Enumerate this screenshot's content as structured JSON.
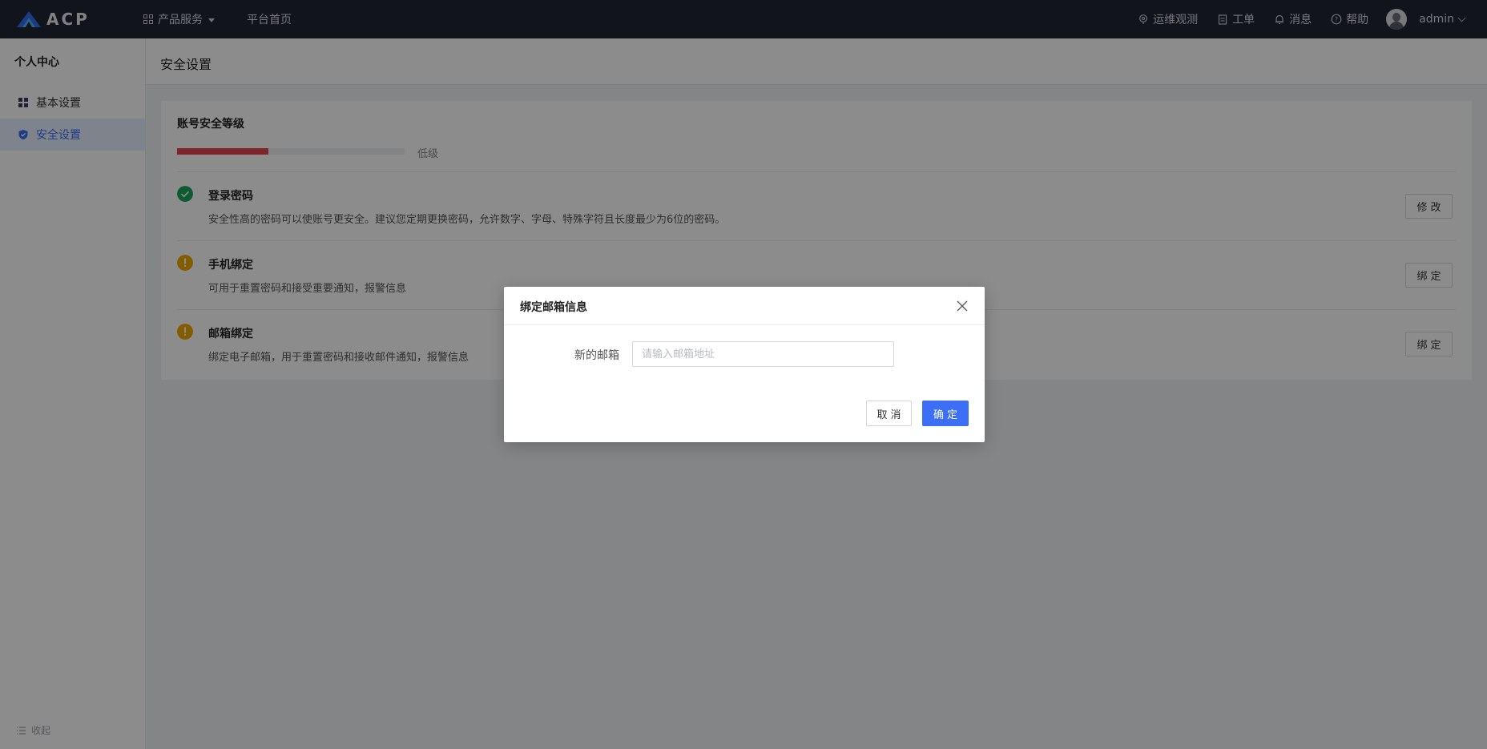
{
  "app": {
    "logo_text": "ACP"
  },
  "topnav": {
    "products_label": "产品服务",
    "home_label": "平台首页"
  },
  "topright": {
    "ops_label": "运维观测",
    "tickets_label": "工单",
    "messages_label": "消息",
    "help_label": "帮助",
    "user_name": "admin"
  },
  "sidebar": {
    "title": "个人中心",
    "items": [
      {
        "label": "基本设置",
        "icon": "grid-icon",
        "active": false
      },
      {
        "label": "安全设置",
        "icon": "shield-icon",
        "active": true
      }
    ],
    "collapse_label": "收起"
  },
  "page": {
    "title": "安全设置"
  },
  "security": {
    "title": "账号安全等级",
    "level_fraction": 0.4,
    "level_text": "低级",
    "level_color": "#e8424f",
    "rows": [
      {
        "title": "登录密码",
        "desc": "安全性高的密码可以使账号更安全。建议您定期更换密码，允许数字、字母、特殊字符且长度最少为6位的密码。",
        "button": "修改",
        "status": "ok",
        "icon": "check-circle-icon"
      },
      {
        "title": "手机绑定",
        "desc": "可用于重置密码和接受重要通知，报警信息",
        "button": "绑定",
        "status": "warn",
        "icon": "warning-icon"
      },
      {
        "title": "邮箱绑定",
        "desc": "绑定电子邮箱，用于重置密码和接收邮件通知，报警信息",
        "button": "绑定",
        "status": "warn",
        "icon": "warning-icon"
      }
    ]
  },
  "modal": {
    "title": "绑定邮箱信息",
    "field_label": "新的邮箱",
    "field_value": "",
    "field_placeholder": "请输入邮箱地址",
    "cancel_label": "取消",
    "ok_label": "确定"
  },
  "colors": {
    "topbar_bg": "#1f2532",
    "primary": "#3c6ef6",
    "success": "#1aa55b",
    "warning": "#f0a800",
    "danger": "#e8424f"
  }
}
